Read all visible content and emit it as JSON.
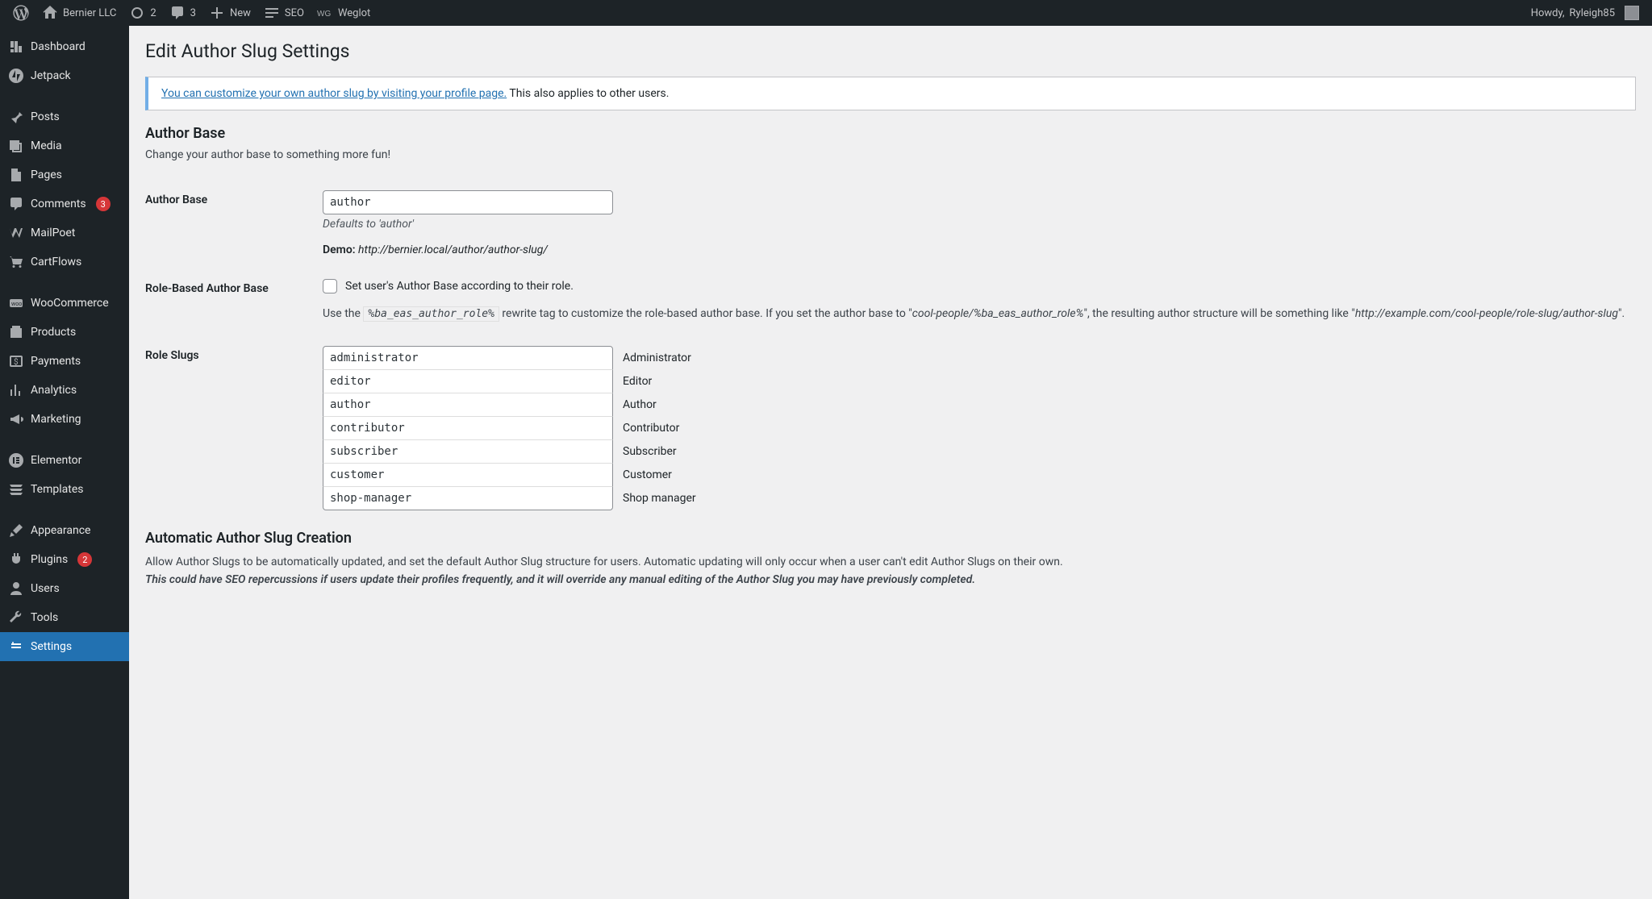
{
  "adminbar": {
    "site_name": "Bernier LLC",
    "updates": "2",
    "comments": "3",
    "new_label": "New",
    "seo_label": "SEO",
    "weglot_label": "Weglot",
    "howdy_prefix": "Howdy,",
    "user_name": "Ryleigh85"
  },
  "menu": {
    "dashboard": "Dashboard",
    "jetpack": "Jetpack",
    "posts": "Posts",
    "media": "Media",
    "pages": "Pages",
    "comments": "Comments",
    "comments_count": "3",
    "mailpoet": "MailPoet",
    "cartflows": "CartFlows",
    "woocommerce": "WooCommerce",
    "products": "Products",
    "payments": "Payments",
    "analytics": "Analytics",
    "marketing": "Marketing",
    "elementor": "Elementor",
    "templates": "Templates",
    "appearance": "Appearance",
    "plugins": "Plugins",
    "plugins_count": "2",
    "users": "Users",
    "tools": "Tools",
    "settings": "Settings"
  },
  "page": {
    "title": "Edit Author Slug Settings",
    "notice_link": "You can customize your own author slug by visiting your profile page.",
    "notice_rest": " This also applies to other users.",
    "author_base_heading": "Author Base",
    "author_base_desc": "Change your author base to something more fun!",
    "author_base_label": "Author Base",
    "author_base_value": "author",
    "author_base_hint": "Defaults to 'author'",
    "demo_label": "Demo:",
    "demo_url": "http://bernier.local/author/author-slug/",
    "role_based_label": "Role-Based Author Base",
    "role_based_checkbox": "Set user's Author Base according to their role.",
    "role_para_before": "Use the ",
    "role_tag": "%ba_eas_author_role%",
    "role_para_mid1": " rewrite tag to customize the role-based author base. If you set the author base to \"",
    "role_example1": "cool-people/%ba_eas_author_role%",
    "role_para_mid2": "\", the resulting author structure will be something like \"",
    "role_example2": "http://example.com/cool-people/role-slug/author-slug",
    "role_para_end": "\".",
    "role_slugs_label": "Role Slugs",
    "roles": [
      {
        "slug": "administrator",
        "label": "Administrator"
      },
      {
        "slug": "editor",
        "label": "Editor"
      },
      {
        "slug": "author",
        "label": "Author"
      },
      {
        "slug": "contributor",
        "label": "Contributor"
      },
      {
        "slug": "subscriber",
        "label": "Subscriber"
      },
      {
        "slug": "customer",
        "label": "Customer"
      },
      {
        "slug": "shop-manager",
        "label": "Shop manager"
      }
    ],
    "auto_heading": "Automatic Author Slug Creation",
    "auto_p1": "Allow Author Slugs to be automatically updated, and set the default Author Slug structure for users. Automatic updating will only occur when a user can't edit Author Slugs on their own.",
    "auto_warn": "This could have SEO repercussions if users update their profiles frequently, and it will override any manual editing of the Author Slug you may have previously completed."
  }
}
